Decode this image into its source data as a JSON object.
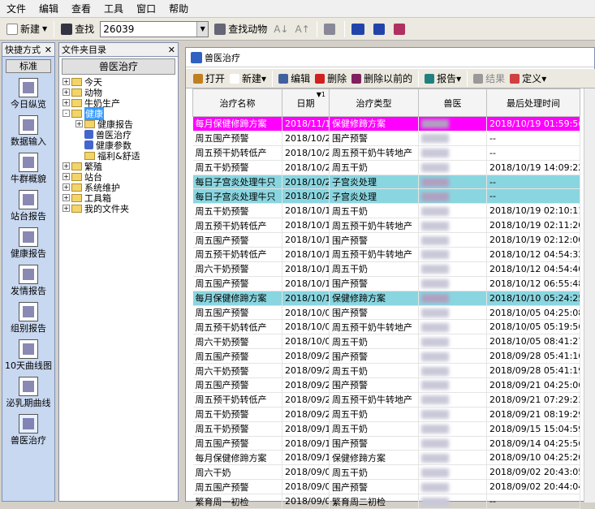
{
  "menu": [
    "文件",
    "编辑",
    "查看",
    "工具",
    "窗口",
    "帮助"
  ],
  "toolbar": {
    "new_label": "新建",
    "find_label": "查找",
    "search_value": "26039",
    "find_animal_label": "查找动物"
  },
  "quick": {
    "header": "快捷方式",
    "std_label": "标准",
    "items": [
      "今日纵览",
      "数据输入",
      "牛群概貌",
      "站台报告",
      "健康报告",
      "发情报告",
      "组别报告",
      "10天曲线图",
      "泌乳期曲线",
      "兽医治疗"
    ]
  },
  "tree": {
    "header": "文件夹目录",
    "title": "兽医治疗",
    "nodes": [
      {
        "label": "今天",
        "level": 0,
        "kind": "folder",
        "pm": "+"
      },
      {
        "label": "动物",
        "level": 0,
        "kind": "folder",
        "pm": "+"
      },
      {
        "label": "牛奶生产",
        "level": 0,
        "kind": "folder",
        "pm": "+"
      },
      {
        "label": "健康",
        "level": 0,
        "kind": "folder",
        "pm": "-",
        "hl": true
      },
      {
        "label": "健康报告",
        "level": 1,
        "kind": "folder",
        "pm": "+"
      },
      {
        "label": "兽医治疗",
        "level": 1,
        "kind": "item"
      },
      {
        "label": "健康参数",
        "level": 1,
        "kind": "item"
      },
      {
        "label": "福利&舒适",
        "level": 1,
        "kind": "folder"
      },
      {
        "label": "繁殖",
        "level": 0,
        "kind": "folder",
        "pm": "+"
      },
      {
        "label": "站台",
        "level": 0,
        "kind": "folder",
        "pm": "+"
      },
      {
        "label": "系统维护",
        "level": 0,
        "kind": "folder",
        "pm": "+"
      },
      {
        "label": "工具箱",
        "level": 0,
        "kind": "folder",
        "pm": "+"
      },
      {
        "label": "我的文件夹",
        "level": 0,
        "kind": "folder",
        "pm": "+"
      }
    ]
  },
  "main": {
    "title": "兽医治疗",
    "tools": [
      "打开",
      "新建",
      "编辑",
      "删除",
      "删除以前的",
      "报告",
      "结果",
      "定义"
    ],
    "columns": [
      "治疗名称",
      "日期",
      "治疗类型",
      "兽医",
      "最后处理时间"
    ],
    "sort_mark": "1",
    "rows": [
      [
        "每月保健修蹄方案",
        "2018/11/10",
        "保健修蹄方案",
        "",
        "2018/10/19 01:59:56",
        "mag"
      ],
      [
        "周五围产预警",
        "2018/10/26",
        "围产预警",
        "",
        "--",
        ""
      ],
      [
        "周五预干奶转低产",
        "2018/10/26",
        "周五预干奶牛转地产",
        "",
        "--",
        ""
      ],
      [
        "周五干奶预警",
        "2018/10/26",
        "周五干奶",
        "",
        "2018/10/19 14:09:22",
        ""
      ],
      [
        "每日子宫炎处理牛只",
        "2018/10/21",
        "子宫炎处理",
        "",
        "--",
        "cyan"
      ],
      [
        "每日子宫炎处理牛只",
        "2018/10/20",
        "子宫炎处理",
        "",
        "--",
        "cyan"
      ],
      [
        "周五干奶预警",
        "2018/10/19",
        "周五干奶",
        "",
        "2018/10/19 02:10:11",
        ""
      ],
      [
        "周五预干奶转低产",
        "2018/10/19",
        "周五预干奶牛转地产",
        "",
        "2018/10/19 02:11:20",
        ""
      ],
      [
        "周五围产预警",
        "2018/10/19",
        "围产预警",
        "",
        "2018/10/19 02:12:00",
        ""
      ],
      [
        "周五预干奶转低产",
        "2018/10/12",
        "周五预干奶牛转地产",
        "",
        "2018/10/12 04:54:32",
        ""
      ],
      [
        "周六干奶预警",
        "2018/10/12",
        "周五干奶",
        "",
        "2018/10/12 04:54:40",
        ""
      ],
      [
        "周五围产预警",
        "2018/10/12",
        "围产预警",
        "",
        "2018/10/12 06:55:48",
        ""
      ],
      [
        "每月保健修蹄方案",
        "2018/10/10",
        "保健修蹄方案",
        "",
        "2018/10/10 05:24:25",
        "cyan"
      ],
      [
        "周五围产预警",
        "2018/10/05",
        "围产预警",
        "",
        "2018/10/05 04:25:08",
        ""
      ],
      [
        "周五预干奶转低产",
        "2018/10/05",
        "周五预干奶牛转地产",
        "",
        "2018/10/05 05:19:56",
        ""
      ],
      [
        "周六干奶预警",
        "2018/10/05",
        "周五干奶",
        "",
        "2018/10/05 08:41:27",
        ""
      ],
      [
        "周五围产预警",
        "2018/09/28",
        "围产预警",
        "",
        "2018/09/28 05:41:16",
        ""
      ],
      [
        "周六干奶预警",
        "2018/09/28",
        "周五干奶",
        "",
        "2018/09/28 05:41:19",
        ""
      ],
      [
        "周五围产预警",
        "2018/09/21",
        "围产预警",
        "",
        "2018/09/21 04:25:06",
        ""
      ],
      [
        "周五预干奶转低产",
        "2018/09/21",
        "周五预干奶牛转地产",
        "",
        "2018/09/21 07:29:23",
        ""
      ],
      [
        "周五干奶预警",
        "2018/09/21",
        "周五干奶",
        "",
        "2018/09/21 08:19:29",
        ""
      ],
      [
        "周五干奶预警",
        "2018/09/15",
        "周五干奶",
        "",
        "2018/09/15 15:04:59",
        ""
      ],
      [
        "周五围产预警",
        "2018/09/14",
        "围产预警",
        "",
        "2018/09/14 04:25:56",
        ""
      ],
      [
        "每月保健修蹄方案",
        "2018/09/10",
        "保健修蹄方案",
        "",
        "2018/09/10 04:25:20",
        ""
      ],
      [
        "周六干奶",
        "2018/09/08",
        "周五干奶",
        "",
        "2018/09/02 20:43:05",
        ""
      ],
      [
        "周五围产预警",
        "2018/09/07",
        "围产预警",
        "",
        "2018/09/02 20:44:04",
        ""
      ],
      [
        "繁育周一初检",
        "2018/09/03",
        "繁育周二初检",
        "",
        "--",
        ""
      ]
    ]
  }
}
